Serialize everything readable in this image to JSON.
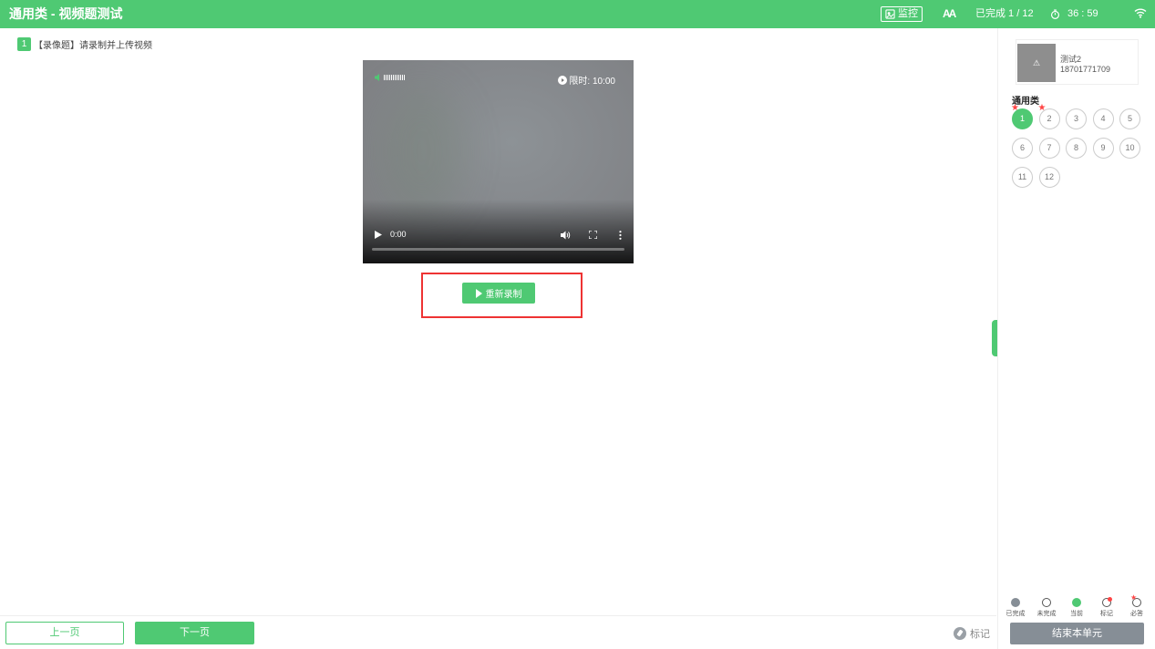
{
  "header": {
    "title": "通用类 - 视频题测试",
    "monitor_label": "监控",
    "progress": "已完成 1 / 12",
    "timer": "36 : 59"
  },
  "question": {
    "number": "1",
    "text": "【录像题】请录制并上传视频"
  },
  "video": {
    "limit": "限时: 10:00",
    "current_time": "0:00"
  },
  "rerecord_label": "重新录制",
  "nav": {
    "prev_label": "上一页",
    "next_label": "下一页",
    "mark_label": "标记"
  },
  "profile": {
    "avatar_alt": "⚠",
    "name": "测试2",
    "phone": "18701771709"
  },
  "section_title": "通用类",
  "questions": [
    {
      "num": "1",
      "state": "current",
      "required": true
    },
    {
      "num": "2",
      "state": "undone",
      "required": true
    },
    {
      "num": "3",
      "state": "undone",
      "required": false
    },
    {
      "num": "4",
      "state": "undone",
      "required": false
    },
    {
      "num": "5",
      "state": "undone",
      "required": false
    },
    {
      "num": "6",
      "state": "undone",
      "required": false
    },
    {
      "num": "7",
      "state": "undone",
      "required": false
    },
    {
      "num": "8",
      "state": "undone",
      "required": false
    },
    {
      "num": "9",
      "state": "undone",
      "required": false
    },
    {
      "num": "10",
      "state": "undone",
      "required": false
    },
    {
      "num": "11",
      "state": "undone",
      "required": false
    },
    {
      "num": "12",
      "state": "undone",
      "required": false
    }
  ],
  "legend": {
    "done": "已完成",
    "undone": "未完成",
    "current": "当前",
    "marked": "标记",
    "required": "必答"
  },
  "end_label": "结束本单元",
  "colors": {
    "brand": "#4fc973",
    "highlight": "#e33333",
    "end_button": "#868e96"
  }
}
